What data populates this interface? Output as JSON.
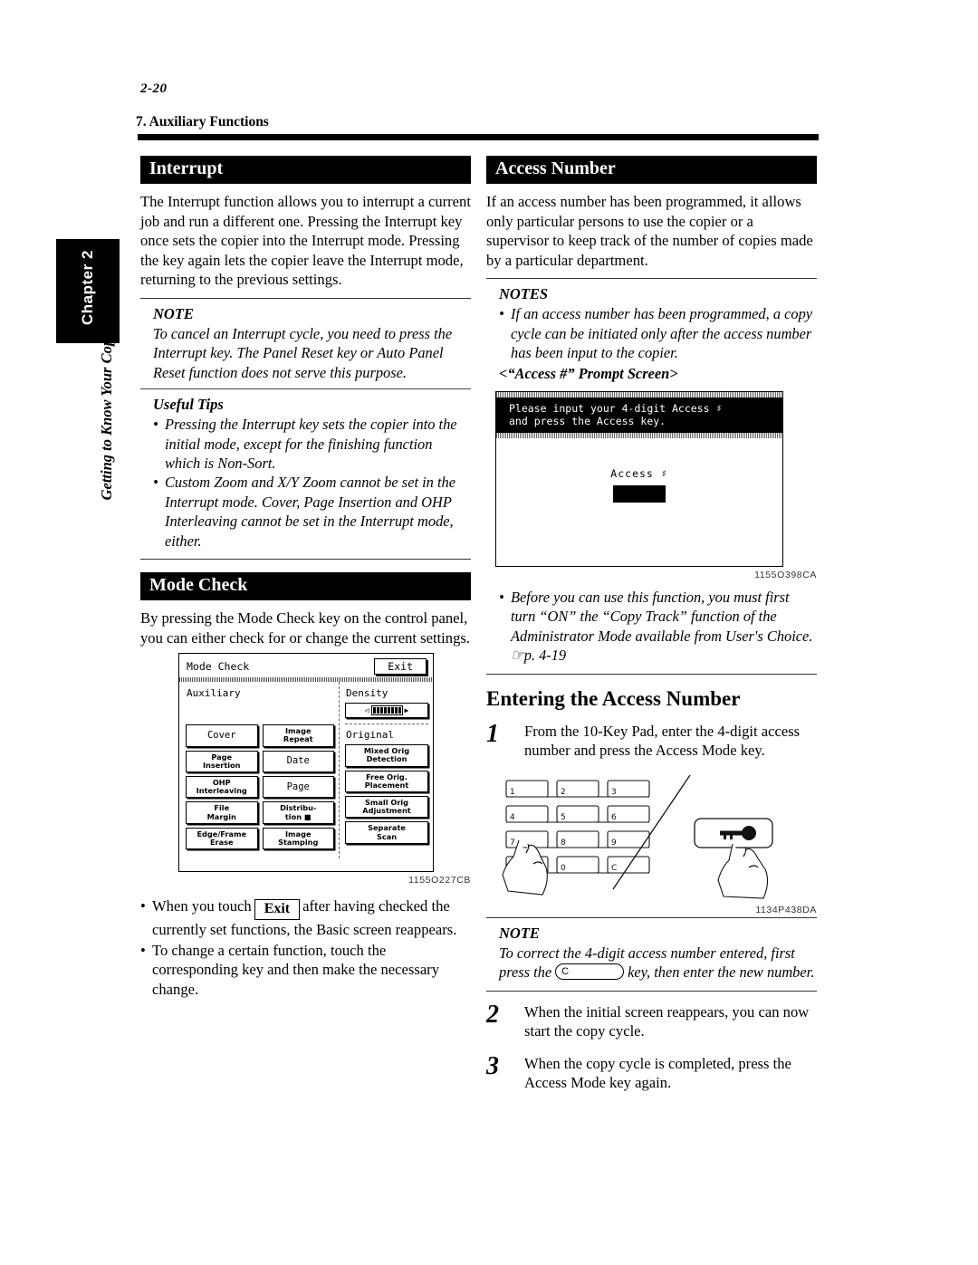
{
  "page": {
    "folio": "2-20",
    "running_head": "7. Auxiliary Functions",
    "chapter_tab": "Chapter 2",
    "chapter_title": "Getting to Know Your Copier"
  },
  "left_column": {
    "interrupt": {
      "heading": "Interrupt",
      "body": "The Interrupt function allows you to interrupt a current job and run a different one. Pressing the Interrupt key once sets the copier into the Interrupt mode. Pressing the key again lets the copier leave the Interrupt mode, returning to the previous settings.",
      "note_title": "NOTE",
      "note_text": "To cancel an Interrupt cycle, you need to press the Interrupt key. The Panel Reset key or Auto Panel Reset function does not serve this purpose.",
      "tips_title": "Useful Tips",
      "tips": [
        "Pressing the Interrupt key sets the copier into the initial mode, except for the finishing function which is Non-Sort.",
        "Custom Zoom and X/Y Zoom cannot be set in the Interrupt mode. Cover, Page Insertion and OHP Interleaving cannot be set in the Interrupt mode, either."
      ]
    },
    "mode_check": {
      "heading": "Mode Check",
      "body": "By pressing the Mode Check key on the control panel, you can either check for or change the current settings.",
      "figure": {
        "title": "Mode Check",
        "exit_label": "Exit",
        "section_auxiliary": "Auxiliary",
        "section_density": "Density",
        "section_original": "Original",
        "aux_keys": [
          [
            "Cover",
            "Image\nRepeat"
          ],
          [
            "Page\nInsertion",
            "Date"
          ],
          [
            "OHP\nInterleaving",
            "Page"
          ],
          [
            "File\nMargin",
            "Distribu-\ntion ■"
          ],
          [
            "Edge/Frame\nErase",
            "Image Stamping"
          ]
        ],
        "original_keys": [
          "Mixed Orig\nDetection",
          "Free Orig.\nPlacement",
          "Small Orig\nAdjustment",
          "Separate\nScan"
        ],
        "caption": "1155O227CB"
      },
      "bullets": [
        {
          "pre": "When you touch",
          "key": "Exit",
          "post": "after having checked the currently set functions, the Basic screen reappears."
        },
        {
          "pre": "To change a certain function, touch the corresponding key and then make the necessary change.",
          "key": "",
          "post": ""
        }
      ]
    }
  },
  "right_column": {
    "access_number": {
      "heading": "Access Number",
      "body": "If an access number has been programmed, it allows only particular persons to use the copier or a supervisor to keep track of the number of copies made by a particular department.",
      "notes_title": "NOTES",
      "note_1": "If an access number has been programmed, a copy cycle can be initiated only after the access number has been input to the copier.",
      "screen_caption_label": "<“Access #” Prompt Screen>",
      "prompt_screen": {
        "message_line_1": "Please input your 4-digit Access ♯",
        "message_line_2": "and press the Access key.",
        "field_label": "Access ♯",
        "caption": "1155O398CA"
      },
      "note_2": "Before you can use this function, you must first turn “ON” the “Copy Track” function of the Administrator Mode available from User's Choice. ☞p. 4-19"
    },
    "entering": {
      "heading": "Entering the Access Number",
      "steps": [
        {
          "num": "1",
          "text": "From the 10-Key Pad, enter the 4-digit access number and press the Access Mode key."
        },
        {
          "num": "2",
          "text": "When the initial screen reappears, you can now start the copy cycle."
        },
        {
          "num": "3",
          "text": "When the copy cycle is completed, press the Access Mode key again."
        }
      ],
      "keypad": {
        "rows": [
          [
            "1",
            "2",
            "3"
          ],
          [
            "4",
            "5",
            "6"
          ],
          [
            "7",
            "8",
            "9"
          ],
          [
            "",
            "0",
            "C"
          ]
        ],
        "access_key_icon": "key-icon",
        "caption": "1134P438DA"
      },
      "note_title": "NOTE",
      "note_pre": "To correct the 4-digit access number entered, first press the",
      "note_key": "C",
      "note_post": "key, then enter the new number."
    }
  }
}
